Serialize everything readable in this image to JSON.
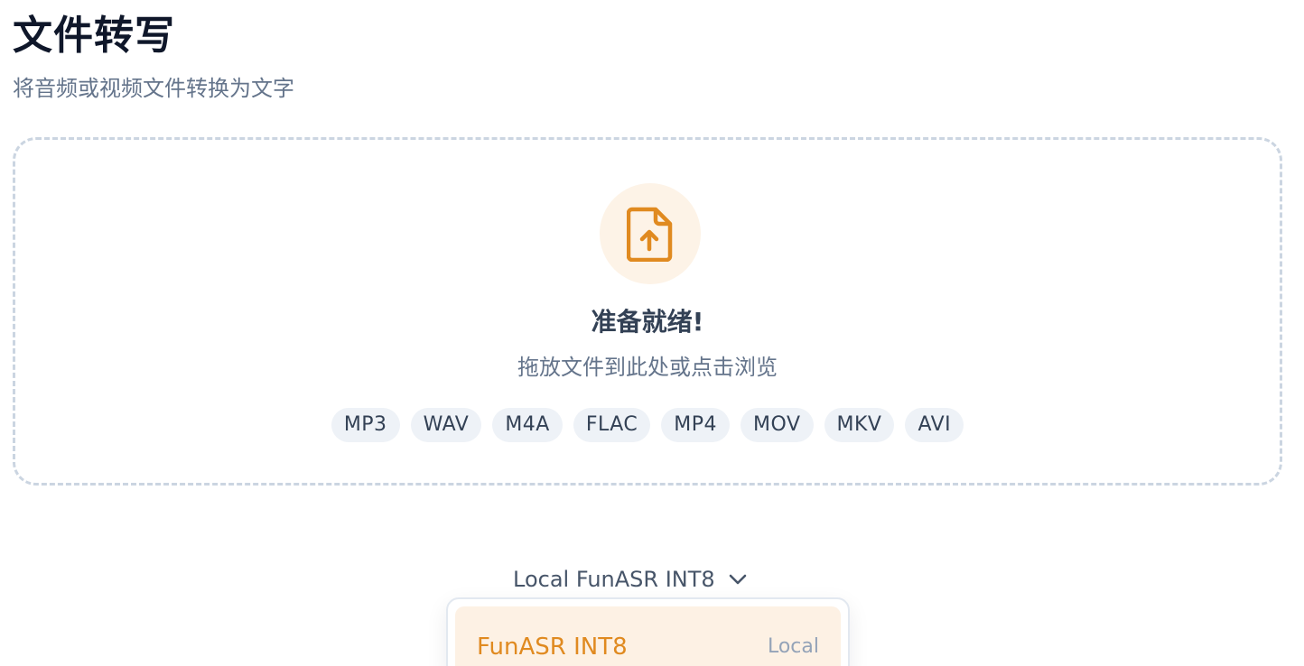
{
  "header": {
    "title": "文件转写",
    "subtitle": "将音频或视频文件转换为文字"
  },
  "dropzone": {
    "icon": "file-upload-icon",
    "title": "准备就绪!",
    "hint": "拖放文件到此处或点击浏览",
    "formats": [
      "MP3",
      "WAV",
      "M4A",
      "FLAC",
      "MP4",
      "MOV",
      "MKV",
      "AVI"
    ]
  },
  "model_selector": {
    "selected_label": "Local FunASR INT8",
    "icon": "chevron-down-icon",
    "options": [
      {
        "name": "FunASR INT8",
        "tag": "Local"
      }
    ]
  },
  "colors": {
    "accent": "#E08A20",
    "accent_soft": "#FDF1E4",
    "dashed_border": "#CBD5E1",
    "chip_bg": "#EEF2F7"
  }
}
